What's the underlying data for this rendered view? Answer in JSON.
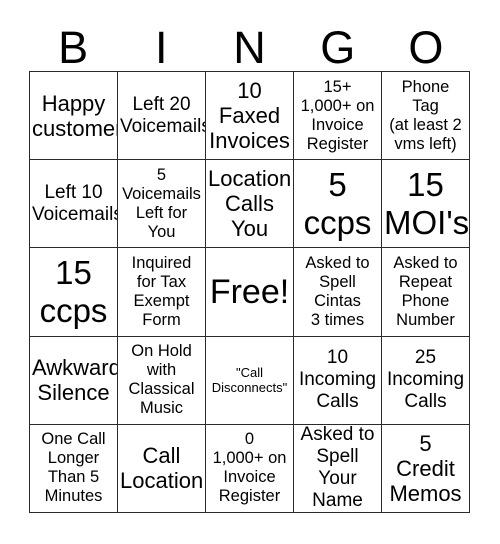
{
  "card": {
    "title": "BINGO",
    "header_letters": [
      "B",
      "I",
      "N",
      "G",
      "O"
    ],
    "free_space_label": "Free!",
    "colors": {
      "background": "#ffffff",
      "border": "#2b2b2b",
      "text": "#000000"
    },
    "rows": [
      [
        {
          "text": "Happy\ncustomer",
          "size": "lg"
        },
        {
          "text": "Left 20\nVoicemails",
          "size": "md"
        },
        {
          "text": "10\nFaxed\nInvoices",
          "size": "lg"
        },
        {
          "text": "15+\n1,000+ on\nInvoice\nRegister",
          "size": "sm"
        },
        {
          "text": "Phone\nTag\n(at least 2\nvms left)",
          "size": "sm"
        }
      ],
      [
        {
          "text": "Left 10\nVoicemails",
          "size": "md"
        },
        {
          "text": "5\nVoicemails\nLeft for\nYou",
          "size": "sm"
        },
        {
          "text": "Location\nCalls\nYou",
          "size": "lg"
        },
        {
          "text": "5\nccps",
          "size": "xxl"
        },
        {
          "text": "15\nMOI's",
          "size": "xxl"
        }
      ],
      [
        {
          "text": "15\nccps",
          "size": "xxl"
        },
        {
          "text": "Inquired\nfor Tax\nExempt\nForm",
          "size": "sm"
        },
        {
          "text": "Free!",
          "size": "free"
        },
        {
          "text": "Asked to\nSpell\nCintas\n3 times",
          "size": "sm"
        },
        {
          "text": "Asked to\nRepeat\nPhone\nNumber",
          "size": "sm"
        }
      ],
      [
        {
          "text": "Awkward\nSilence",
          "size": "lg"
        },
        {
          "text": "On Hold\nwith\nClassical\nMusic",
          "size": "sm"
        },
        {
          "text": "\"Call\nDisconnects\"",
          "size": "xs"
        },
        {
          "text": "10\nIncoming\nCalls",
          "size": "md"
        },
        {
          "text": "25\nIncoming\nCalls",
          "size": "md"
        }
      ],
      [
        {
          "text": "One Call\nLonger\nThan 5\nMinutes",
          "size": "sm"
        },
        {
          "text": "Call\nLocation",
          "size": "lg"
        },
        {
          "text": "0\n1,000+ on\nInvoice\nRegister",
          "size": "sm"
        },
        {
          "text": "Asked to\nSpell Your\nName",
          "size": "md"
        },
        {
          "text": "5\nCredit\nMemos",
          "size": "lg"
        }
      ]
    ]
  }
}
